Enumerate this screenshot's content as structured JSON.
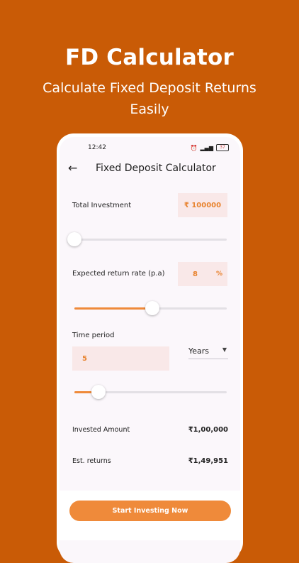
{
  "promo": {
    "title": "FD Calculator",
    "subtitle_line1": "Calculate Fixed Deposit Returns",
    "subtitle_line2": "Easily"
  },
  "status_bar": {
    "time": "12:42",
    "battery": "37"
  },
  "app_bar": {
    "title": "Fixed Deposit Calculator",
    "back_icon": "arrow-left-icon"
  },
  "total_investment": {
    "label": "Total Investment",
    "value": "₹ 100000",
    "slider_fraction": 0.0
  },
  "return_rate": {
    "label": "Expected return rate (p.a)",
    "value": "8",
    "unit": "%",
    "slider_fraction": 0.51
  },
  "time_period": {
    "label": "Time period",
    "value": "5",
    "unit_selected": "Years",
    "slider_fraction": 0.16
  },
  "summary": [
    {
      "label": "Invested Amount",
      "value": "₹1,00,000"
    },
    {
      "label": "Est. returns",
      "value": "₹1,49,951"
    }
  ],
  "cta_label": "Start Investing Now",
  "colors": {
    "background": "#c95b06",
    "accent": "#ef8a3a",
    "field_bg": "#f9e8e8"
  }
}
